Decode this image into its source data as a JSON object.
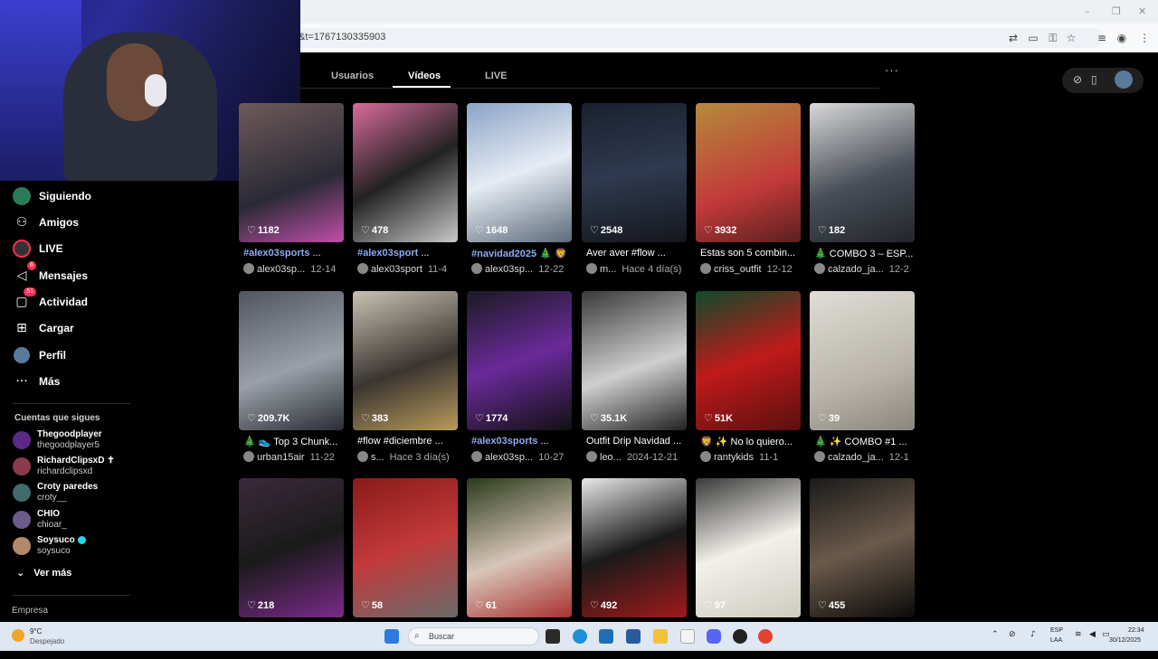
{
  "browser": {
    "url": "&t=1767130335903",
    "controls": {
      "minimize": "–",
      "restore": "❐",
      "close": "✕"
    }
  },
  "tabs": [
    {
      "label": "Usuarios",
      "active": false
    },
    {
      "label": "Vídeos",
      "active": true
    },
    {
      "label": "LIVE",
      "active": false
    }
  ],
  "more_options": "···",
  "sidebar": {
    "items": [
      {
        "label": "Siguiendo",
        "icon": "following-icon"
      },
      {
        "label": "Amigos",
        "icon": "friends-icon"
      },
      {
        "label": "LIVE",
        "icon": "live-icon"
      },
      {
        "label": "Mensajes",
        "icon": "messages-icon",
        "badge": "6"
      },
      {
        "label": "Actividad",
        "icon": "activity-icon",
        "badge": "51"
      },
      {
        "label": "Cargar",
        "icon": "upload-icon"
      },
      {
        "label": "Perfil",
        "icon": "profile-icon"
      },
      {
        "label": "Más",
        "icon": "more-icon"
      }
    ],
    "following_title": "Cuentas que sigues",
    "accounts": [
      {
        "name": "Thegoodplayer",
        "handle": "thegoodplayer5",
        "color": "#5b2a86"
      },
      {
        "name": "RichardClipsxD ✝",
        "handle": "richardclipsxd",
        "color": "#8a3b4c"
      },
      {
        "name": "Croty paredes",
        "handle": "croty__",
        "color": "#3e6b6b"
      },
      {
        "name": "CHIO",
        "handle": "chioar_",
        "color": "#6b5a8a"
      },
      {
        "name": "Soysuco",
        "handle": "soysuco",
        "color": "#b08a6a",
        "verified": true
      }
    ],
    "see_more": "Ver más",
    "company": "Empresa"
  },
  "videos": [
    {
      "likes": "1182",
      "caption_tag": "#alex03sports",
      "caption": " ...",
      "author": "alex03sp...",
      "date": "12-14",
      "bg": "linear-gradient(160deg,#6e5a5a,#2a2a35 60%,#c04fa8)"
    },
    {
      "likes": "478",
      "caption_tag": "#alex03sport",
      "caption": " ...",
      "author": "alex03sport",
      "date": "11-4",
      "bg": "linear-gradient(150deg,#d96b9b,#222 50%,#c8c8c8)"
    },
    {
      "likes": "1648",
      "caption_tag": "#navidad2025",
      "caption": " 🎄 🦁",
      "author": "alex03sp...",
      "date": "12-22",
      "bg": "linear-gradient(160deg,#8aa3c6,#e6ecf4 50%,#5d6a7a)"
    },
    {
      "likes": "2548",
      "caption_tag": "",
      "caption": "Aver aver #flow ...",
      "author": "m...",
      "date": "Hace 4 día(s)",
      "bg": "linear-gradient(170deg,#1a2030,#2f3a50 50%,#15171c)"
    },
    {
      "likes": "3932",
      "caption_tag": "",
      "caption": "Estas son 5 combin...",
      "author": "criss_outfit",
      "date": "12-12",
      "bg": "linear-gradient(160deg,#b58a3a,#c23a3a 60%,#5a2020)"
    },
    {
      "likes": "182",
      "caption_tag": "",
      "caption": "🎄 COMBO 3 – ESP...",
      "author": "calzado_ja...",
      "date": "12-2",
      "bg": "linear-gradient(160deg,#d8d8d8,#4a4f58 55%,#22252b)"
    },
    {
      "likes": "209.7K",
      "caption_tag": "",
      "caption": "🎄 👟 Top 3 Chunk...",
      "author": "urban15air",
      "date": "11-22",
      "bg": "linear-gradient(160deg,#505560,#9aa0a8 55%,#2a2d33)"
    },
    {
      "likes": "383",
      "caption_tag": "",
      "caption": "#flow #diciembre ...",
      "author": "s...",
      "date": "Hace 3 día(s)",
      "bg": "linear-gradient(160deg,#c9c2b3,#3a3530 55%,#b89a5a)"
    },
    {
      "likes": "1774",
      "caption_tag": "#alex03sports",
      "caption": " ...",
      "author": "alex03sp...",
      "date": "10-27",
      "bg": "linear-gradient(160deg,#1a1a22,#6a2a9a 50%,#111)"
    },
    {
      "likes": "35.1K",
      "caption_tag": "",
      "caption": "Outfit Drip Navidad ...",
      "author": "leo...",
      "date": "2024-12-21",
      "bg": "linear-gradient(160deg,#3a3a3a,#cfcfcf 55%,#222)"
    },
    {
      "likes": "51K",
      "caption_tag": "",
      "caption": "🦁 ✨ No lo quiero...",
      "author": "rantykids",
      "date": "11-1",
      "bg": "linear-gradient(160deg,#0e4a2a,#c01a1a 50%,#5a1010)"
    },
    {
      "likes": "39",
      "caption_tag": "",
      "caption": "🎄 ✨ COMBO #1 ...",
      "author": "calzado_ja...",
      "date": "12-1",
      "bg": "linear-gradient(160deg,#e0ddd6,#b9b5ac 60%,#8a867e)"
    },
    {
      "likes": "218",
      "caption_tag": "",
      "caption": "",
      "author": "",
      "date": "",
      "bg": "linear-gradient(160deg,#3a2a3a,#1a1a1a 50%,#7a2a8a)"
    },
    {
      "likes": "58",
      "caption_tag": "",
      "caption": "",
      "author": "",
      "date": "",
      "bg": "linear-gradient(160deg,#8a1a1a,#c23a3a 50%,#6a6a6a)"
    },
    {
      "likes": "61",
      "caption_tag": "",
      "caption": "",
      "author": "",
      "date": "",
      "bg": "linear-gradient(160deg,#2a3a1a,#d8c6b8 55%,#a83030)"
    },
    {
      "likes": "492",
      "caption_tag": "",
      "caption": "",
      "author": "",
      "date": "",
      "bg": "linear-gradient(160deg,#e8e8e8,#1a1a1a 50%,#a01a1a)"
    },
    {
      "likes": "97",
      "caption_tag": "",
      "caption": "",
      "author": "",
      "date": "",
      "bg": "linear-gradient(160deg,#3a3a3a,#f2f0ea 50%,#cfcbc2)"
    },
    {
      "likes": "455",
      "caption_tag": "",
      "caption": "",
      "author": "",
      "date": "",
      "bg": "linear-gradient(160deg,#1a1a1a,#6a5a4a 50%,#0a0a0a)"
    }
  ],
  "taskbar": {
    "temperature": "9°C",
    "weather": "Despejado",
    "search_placeholder": "Buscar",
    "lang_top": "ESP",
    "lang_bottom": "LAA",
    "time": "22:34",
    "date": "30/12/2025"
  }
}
